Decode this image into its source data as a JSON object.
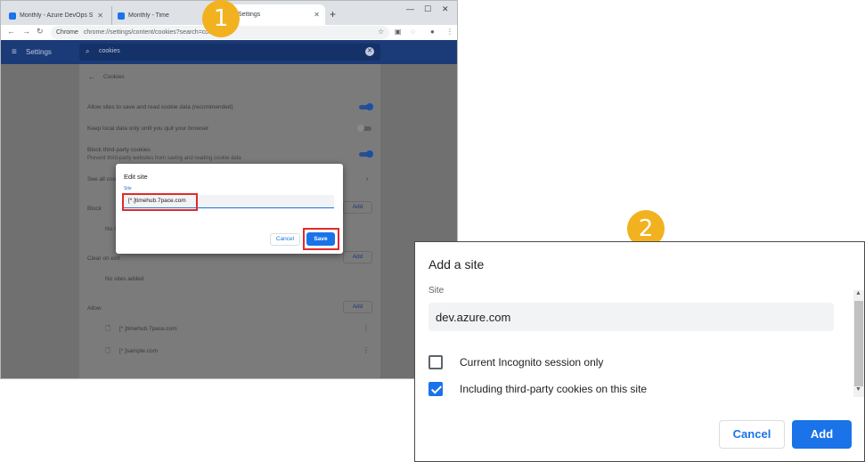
{
  "callouts": {
    "step1": "1",
    "step2": "2"
  },
  "browser": {
    "tabs": [
      {
        "label": "Monthly - Azure DevOps Services"
      },
      {
        "label": "Monthly - Time"
      },
      {
        "label": "Settings"
      }
    ],
    "url_scheme": "Chrome",
    "url": "chrome://settings/content/cookies?search=cookies",
    "settings_title": "Settings",
    "search_value": "cookies"
  },
  "cookies_page": {
    "title": "Cookies",
    "allow_save": "Allow sites to save and read cookie data (recommended)",
    "keep_local": "Keep local data only until you quit your browser",
    "block_third_party": "Block third-party cookies",
    "block_third_party_desc": "Prevent third-party websites from saving and reading cookie data",
    "see_all": "See all cookies and site data",
    "block_section": "Block",
    "block_empty": "No sites added",
    "clear_section": "Clear on exit",
    "clear_empty": "No sites added",
    "allow_section": "Allow",
    "add_label": "Add",
    "allow_sites": [
      "[*.]timehub.7pace.com",
      "[*.]sample.com"
    ]
  },
  "edit_site_dialog": {
    "title": "Edit site",
    "field_label": "Site",
    "value": "[*.]timehub.7pace.com",
    "cancel": "Cancel",
    "save": "Save"
  },
  "add_site_dialog": {
    "title": "Add a site",
    "field_label": "Site",
    "value": "dev.azure.com",
    "option_incognito": "Current Incognito session only",
    "option_incognito_checked": false,
    "option_third_party": "Including third-party cookies on this site",
    "option_third_party_checked": true,
    "cancel": "Cancel",
    "add": "Add"
  },
  "colors": {
    "accent": "#1a73e8",
    "callout": "#f2b21f",
    "highlight": "#e02b2b",
    "header": "#1a3a78"
  }
}
